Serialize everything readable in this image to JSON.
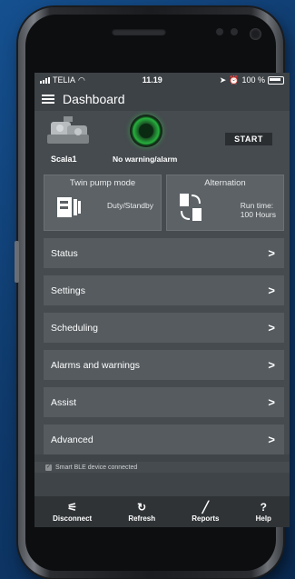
{
  "status_bar": {
    "carrier": "TELIA",
    "time": "11.19",
    "battery": "100 %"
  },
  "header": {
    "title": "Dashboard"
  },
  "device": {
    "name": "Scala1",
    "alarm_status": "No warning/alarm",
    "start_label": "START"
  },
  "tiles": [
    {
      "title": "Twin pump mode",
      "value": "Duty/Standby"
    },
    {
      "title": "Alternation",
      "value_line1": "Run time:",
      "value_line2": "100 Hours"
    }
  ],
  "menu": [
    {
      "label": "Status"
    },
    {
      "label": "Settings"
    },
    {
      "label": "Scheduling"
    },
    {
      "label": "Alarms and warnings"
    },
    {
      "label": "Assist"
    },
    {
      "label": "Advanced"
    }
  ],
  "ble_status": "Smart BLE device connected",
  "bottom_nav": [
    {
      "label": "Disconnect",
      "icon": "disconnect-icon"
    },
    {
      "label": "Refresh",
      "icon": "refresh-icon"
    },
    {
      "label": "Reports",
      "icon": "reports-icon"
    },
    {
      "label": "Help",
      "icon": "help-icon"
    }
  ]
}
